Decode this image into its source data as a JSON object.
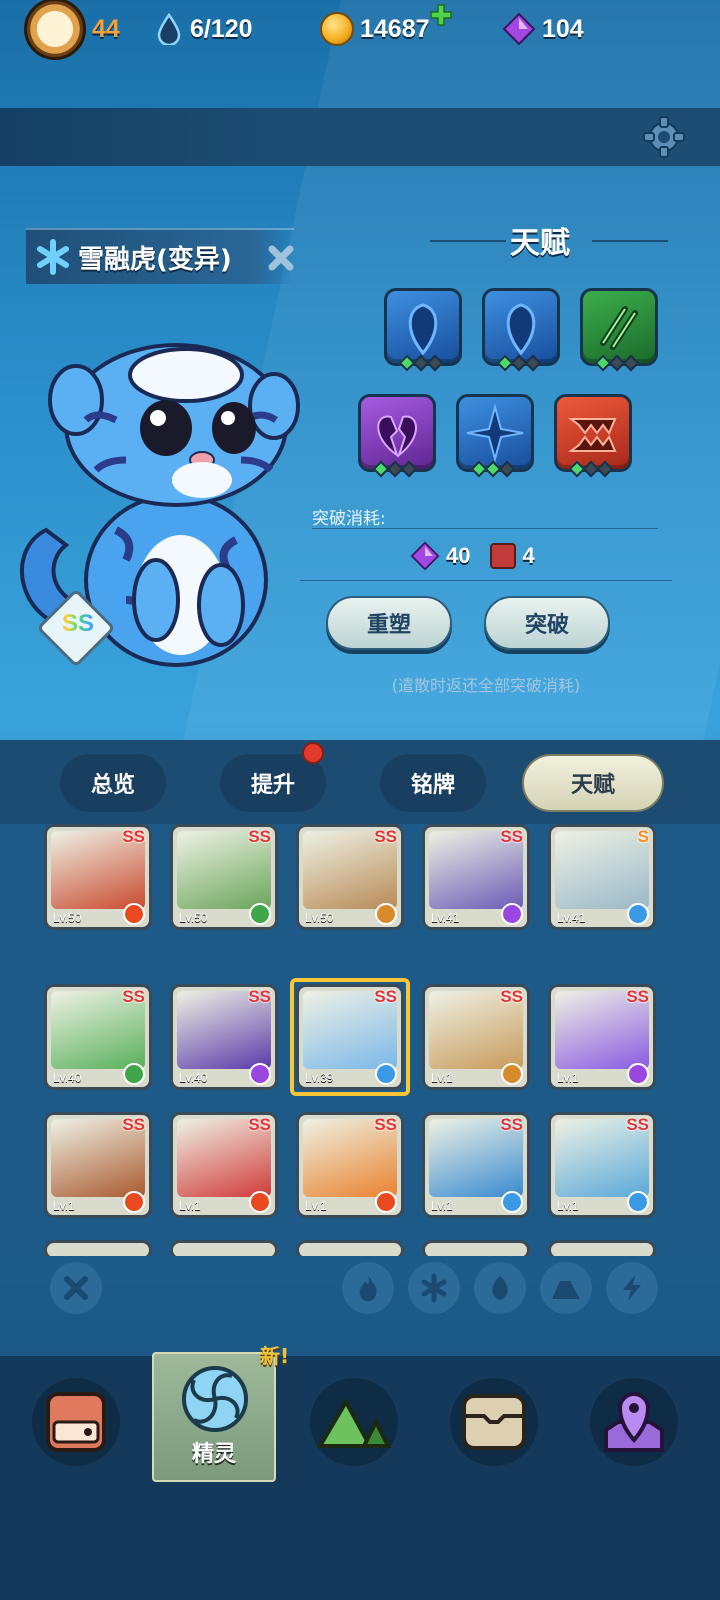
{
  "resources": {
    "level": "44",
    "stamina": "6/120",
    "coins": "14687",
    "gems": "104"
  },
  "pet": {
    "name": "雪融虎(变异)",
    "grade": "SS"
  },
  "talent": {
    "title": "天赋",
    "slots": [
      {
        "icon": "blue-drop-icon",
        "color": "blue",
        "level": 1
      },
      {
        "icon": "blue-drop-icon",
        "color": "blue",
        "level": 1
      },
      {
        "icon": "claw-slash-icon",
        "color": "green",
        "level": 1
      },
      {
        "icon": "broken-heart-icon",
        "color": "purple",
        "level": 1
      },
      {
        "icon": "star-sparkle-icon",
        "color": "blue",
        "level": 2
      },
      {
        "icon": "fang-bite-icon",
        "color": "red",
        "level": 1
      }
    ],
    "cost_label": "突破消耗:",
    "cost_gems": "40",
    "cost_books": "4",
    "reset_button": "重塑",
    "breakthrough_button": "突破",
    "hint": "(遣散时返还全部突破消耗)"
  },
  "tabs": [
    "总览",
    "提升",
    "铭牌",
    "天赋"
  ],
  "active_tab": "天赋",
  "pets_grid": [
    {
      "grade": "SS",
      "level": "Lv.50",
      "element": "fire",
      "color": "#c84a2e"
    },
    {
      "grade": "SS",
      "level": "Lv.50",
      "element": "grass",
      "color": "#6aa55a"
    },
    {
      "grade": "SS",
      "level": "Lv.50",
      "element": "ground",
      "color": "#b88a55"
    },
    {
      "grade": "SS",
      "level": "Lv.41",
      "element": "thunder",
      "color": "#6a5bb5"
    },
    {
      "grade": "S",
      "level": "Lv.41",
      "element": "ice",
      "color": "#9ab8c8"
    },
    {
      "grade": "SS",
      "level": "Lv.40",
      "element": "grass",
      "color": "#58b05a"
    },
    {
      "grade": "SS",
      "level": "Lv.40",
      "element": "thunder",
      "color": "#5a3aa8"
    },
    {
      "grade": "SS",
      "level": "Lv.39",
      "element": "ice",
      "color": "#7ab8e8"
    },
    {
      "grade": "SS",
      "level": "Lv.1",
      "element": "ground",
      "color": "#c89a5a"
    },
    {
      "grade": "SS",
      "level": "Lv.1",
      "element": "thunder",
      "color": "#8a5ae0"
    },
    {
      "grade": "SS",
      "level": "Lv.1",
      "element": "fire",
      "color": "#a85a2e"
    },
    {
      "grade": "SS",
      "level": "Lv.1",
      "element": "fire",
      "color": "#d03a3a"
    },
    {
      "grade": "SS",
      "level": "Lv.1",
      "element": "fire",
      "color": "#e8822e"
    },
    {
      "grade": "SS",
      "level": "Lv.1",
      "element": "ice",
      "color": "#3a8ad0"
    },
    {
      "grade": "SS",
      "level": "Lv.1",
      "element": "ice",
      "color": "#5aa8d8"
    }
  ],
  "filters": [
    "clear",
    "fire",
    "ice",
    "grass",
    "ground",
    "thunder"
  ],
  "bottom_nav": {
    "active_label": "精灵",
    "new_tag": "新!",
    "items": [
      "backpack-icon",
      "spirit-icon",
      "mountain-icon",
      "chest-icon",
      "map-pin-icon"
    ]
  }
}
